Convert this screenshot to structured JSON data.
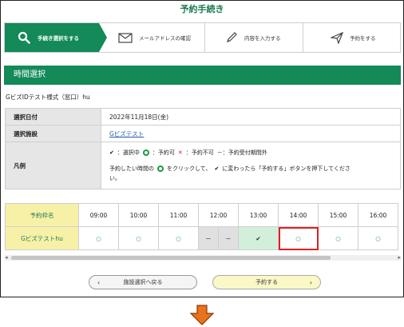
{
  "page": {
    "title": "予約手続き"
  },
  "steps": [
    {
      "label": "手続き選択をする",
      "icon": "search-icon",
      "active": true
    },
    {
      "label": "メールアドレスの確認",
      "icon": "mail-icon"
    },
    {
      "label": "内容を入力する",
      "icon": "pencil-icon"
    },
    {
      "label": "予約をする",
      "icon": "send-icon"
    }
  ],
  "section": {
    "title": "時間選択"
  },
  "facility": {
    "name": "GビズIDテスト様式（窓口）hu"
  },
  "info": {
    "date_label": "選択日付",
    "date_value": "2022年11月18日(金)",
    "facility_label": "選択施設",
    "facility_value": "Gビズテスト",
    "legend_label": "凡例",
    "legend_selected": "：選択中",
    "legend_available": "：予約可",
    "legend_unavailable": "：予約不可",
    "legend_outside": "－：予約受付期間外",
    "instruction_1": "予約したい時間の",
    "instruction_2": "をクリックして、",
    "instruction_3": "に変わったら「予約する」ボタンを押下してくださ",
    "instruction_4": "い。"
  },
  "schedule": {
    "header_name": "予約枠名",
    "times": [
      "09:00",
      "10:00",
      "11:00",
      "12:00",
      "13:00",
      "14:00",
      "15:00",
      "16:00"
    ],
    "row_name": "Gビズテストhu",
    "cells": [
      {
        "status": "available",
        "symbol": "○"
      },
      {
        "status": "available",
        "symbol": "○"
      },
      {
        "status": "available",
        "symbol": "○"
      },
      {
        "status": "outside",
        "symbol": "－"
      },
      {
        "status": "outside",
        "symbol": "－"
      },
      {
        "status": "selected",
        "symbol": "✔"
      },
      {
        "status": "available",
        "symbol": "○",
        "highlighted": true
      },
      {
        "status": "available",
        "symbol": "○"
      },
      {
        "status": "available",
        "symbol": "○"
      }
    ]
  },
  "buttons": {
    "back": "施設選択へ戻る",
    "reserve": "予約する"
  },
  "colors": {
    "brand_green": "#138a58",
    "highlight_red": "#e02020",
    "row_yellow": "#f7f1a8",
    "down_arrow": "#e8731c"
  }
}
